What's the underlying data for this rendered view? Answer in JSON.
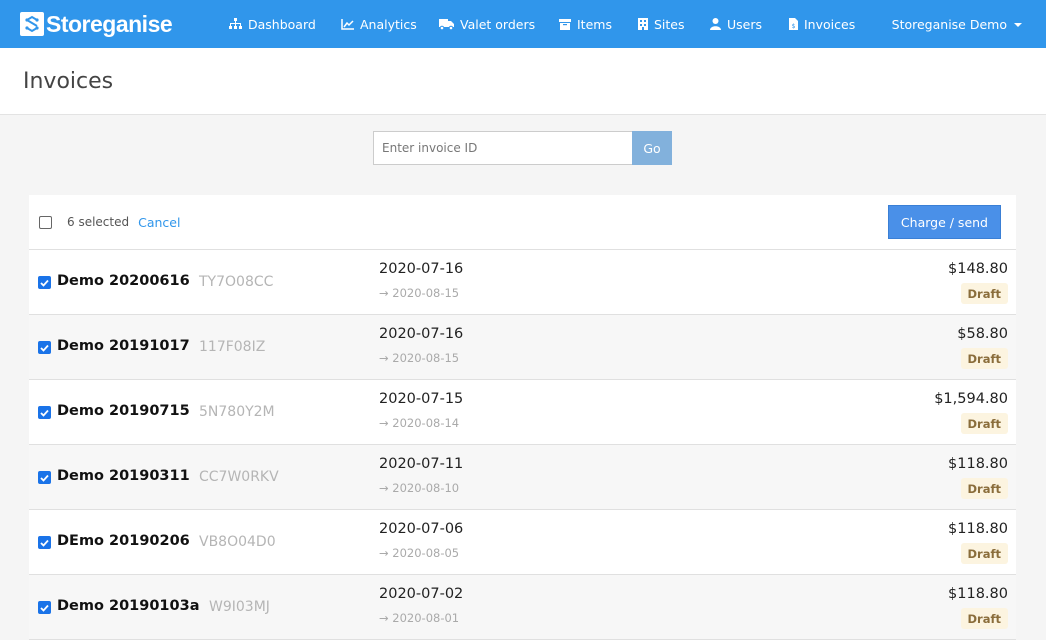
{
  "app": {
    "brand": "Storeganise"
  },
  "nav": {
    "items": [
      {
        "label": "Dashboard",
        "icon": "sitemap-icon"
      },
      {
        "label": "Analytics",
        "icon": "line-chart-icon"
      },
      {
        "label": "Valet orders",
        "icon": "truck-icon"
      },
      {
        "label": "Items",
        "icon": "archive-box-icon"
      },
      {
        "label": "Sites",
        "icon": "building-icon"
      },
      {
        "label": "Users",
        "icon": "user-icon"
      },
      {
        "label": "Invoices",
        "icon": "invoice-icon"
      }
    ],
    "user_menu": "Storeganise Demo"
  },
  "page": {
    "title": "Invoices"
  },
  "search": {
    "placeholder": "Enter invoice ID",
    "value": "",
    "go_label": "Go"
  },
  "selection": {
    "count_label": "6 selected",
    "cancel_label": "Cancel",
    "action_label": "Charge / send"
  },
  "colors": {
    "brand": "#3096eb",
    "draft_badge_bg": "#fcf4e0",
    "draft_badge_text": "#8a6d3b",
    "checkbox": "#1a73e8"
  },
  "invoices": [
    {
      "name": "Demo 20200616",
      "code": "TY7O08CC",
      "date": "2020-07-16",
      "due": "→ 2020-08-15",
      "amount": "$148.80",
      "status": "Draft",
      "checked": true
    },
    {
      "name": "Demo 20191017",
      "code": "117F08IZ",
      "date": "2020-07-16",
      "due": "→ 2020-08-15",
      "amount": "$58.80",
      "status": "Draft",
      "checked": true
    },
    {
      "name": "Demo 20190715",
      "code": "5N780Y2M",
      "date": "2020-07-15",
      "due": "→ 2020-08-14",
      "amount": "$1,594.80",
      "status": "Draft",
      "checked": true
    },
    {
      "name": "Demo 20190311",
      "code": "CC7W0RKV",
      "date": "2020-07-11",
      "due": "→ 2020-08-10",
      "amount": "$118.80",
      "status": "Draft",
      "checked": true
    },
    {
      "name": "DEmo 20190206",
      "code": "VB8O04D0",
      "date": "2020-07-06",
      "due": "→ 2020-08-05",
      "amount": "$118.80",
      "status": "Draft",
      "checked": true
    },
    {
      "name": "Demo 20190103a",
      "code": "W9I03MJ",
      "date": "2020-07-02",
      "due": "→ 2020-08-01",
      "amount": "$118.80",
      "status": "Draft",
      "checked": true
    }
  ]
}
